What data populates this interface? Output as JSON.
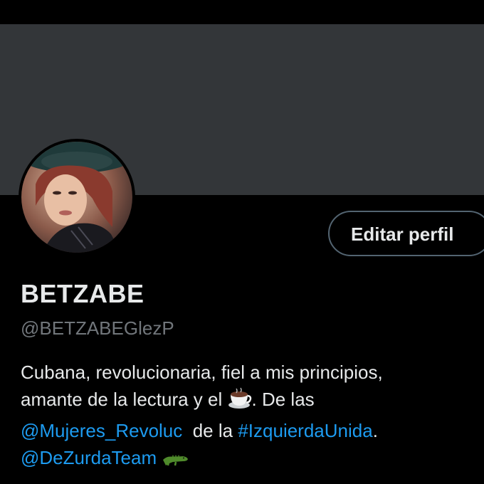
{
  "profile": {
    "display_name": "BETZABE",
    "handle": "@BETZABEGlezP",
    "edit_button_label": "Editar perfil",
    "bio": {
      "line1": "Cubana, revolucionaria, fiel a mis principios,",
      "line2_before_emoji": "amante de la lectura y el",
      "line2_after_emoji": ". De las",
      "mention1": "@Mujeres_Revoluc",
      "connector": "de la",
      "hashtag": "#IzquierdaUnida",
      "period": ".",
      "mention2": "@DeZurdaTeam"
    },
    "bio_emojis": [
      "coffee-cup",
      "crocodile"
    ]
  },
  "colors": {
    "background": "#000000",
    "banner": "#333639",
    "primary_text": "#e7e9ea",
    "secondary_text": "#71767b",
    "link": "#1d9bf0",
    "button_border": "#536471"
  }
}
